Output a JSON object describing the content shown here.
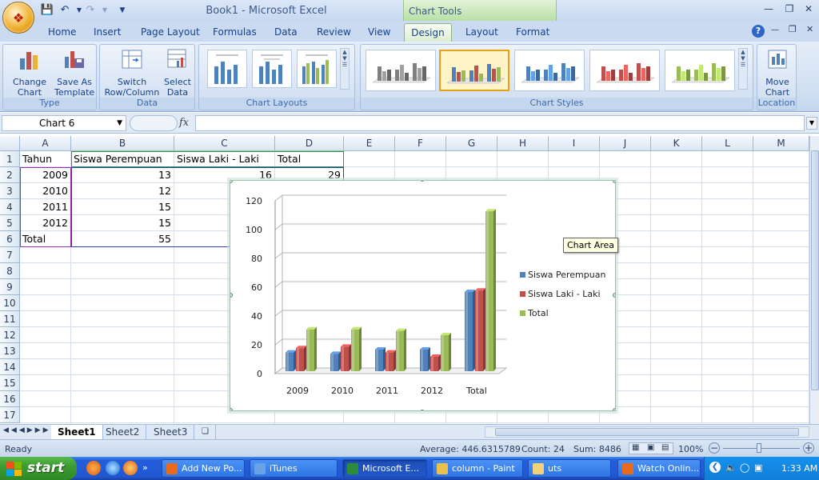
{
  "window": {
    "title": "Book1 - Microsoft Excel",
    "context_tab": "Chart Tools"
  },
  "tabs": [
    "Home",
    "Insert",
    "Page Layout",
    "Formulas",
    "Data",
    "Review",
    "View",
    "Design",
    "Layout",
    "Format"
  ],
  "active_tab": "Design",
  "ribbon": {
    "type_group": {
      "label": "Type",
      "change_chart_type": "Change Chart Type",
      "save_as_template": "Save As Template"
    },
    "data_group": {
      "label": "Data",
      "switch_row_column": "Switch Row/Column",
      "select_data": "Select Data"
    },
    "layouts_group": {
      "label": "Chart Layouts"
    },
    "styles_group": {
      "label": "Chart Styles",
      "styles": [
        "#808080",
        "#4f81bd",
        "#4f81bd",
        "#c0504d",
        "#9bbb59"
      ],
      "selected_index": 1
    },
    "location_group": {
      "label": "Location",
      "move_chart": "Move Chart"
    }
  },
  "formula_bar": {
    "name_box": "Chart 6",
    "fx": "fx",
    "value": ""
  },
  "columns": [
    "A",
    "B",
    "C",
    "D",
    "E",
    "F",
    "G",
    "H",
    "I",
    "J",
    "K",
    "L",
    "M"
  ],
  "rows": [
    "1",
    "2",
    "3",
    "4",
    "5",
    "6",
    "7",
    "8",
    "9",
    "10",
    "11",
    "12",
    "13",
    "14",
    "15",
    "16",
    "17"
  ],
  "cells": {
    "A1": "Tahun",
    "B1": "Siswa Perempuan",
    "C1": "Siswa Laki - Laki",
    "D1": "Total",
    "A2": "2009",
    "B2": "13",
    "C2": "16",
    "D2": "29",
    "A3": "2010",
    "B3": "12",
    "A4": "2011",
    "B4": "15",
    "A5": "2012",
    "B5": "15",
    "A6": "Total",
    "B6": "55"
  },
  "chart_tooltip": "Chart Area",
  "chart_data": {
    "type": "bar",
    "style": "3d-clustered-column",
    "categories": [
      "2009",
      "2010",
      "2011",
      "2012",
      "Total"
    ],
    "series": [
      {
        "name": "Siswa Perempuan",
        "values": [
          13,
          12,
          15,
          15,
          55
        ],
        "color": "#4f81bd"
      },
      {
        "name": "Siswa Laki - Laki",
        "values": [
          16,
          17,
          13,
          10,
          56
        ],
        "color": "#c0504d"
      },
      {
        "name": "Total",
        "values": [
          29,
          29,
          28,
          25,
          111
        ],
        "color": "#9bbb59"
      }
    ],
    "yticks": [
      0,
      20,
      40,
      60,
      80,
      100,
      120
    ],
    "ylim": [
      0,
      120
    ],
    "grid": true,
    "legend_position": "right"
  },
  "sheets": [
    "Sheet1",
    "Sheet2",
    "Sheet3"
  ],
  "active_sheet": "Sheet1",
  "status": {
    "ready": "Ready",
    "average": "Average: 446.6315789",
    "count": "Count: 24",
    "sum": "Sum: 8486",
    "zoom": "100%"
  },
  "taskbar": {
    "start": "start",
    "tasks": [
      {
        "label": "Add New Po...",
        "color": "#e86a1a"
      },
      {
        "label": "iTunes",
        "color": "#6aa2e8"
      },
      {
        "label": "Microsoft E...",
        "color": "#2e8b3a"
      },
      {
        "label": "column - Paint",
        "color": "#e8c04a"
      },
      {
        "label": "uts",
        "color": "#f2d27a"
      },
      {
        "label": "Watch Onlin...",
        "color": "#e86a1a"
      }
    ],
    "active_task": 2,
    "clock": "1:33 AM"
  }
}
